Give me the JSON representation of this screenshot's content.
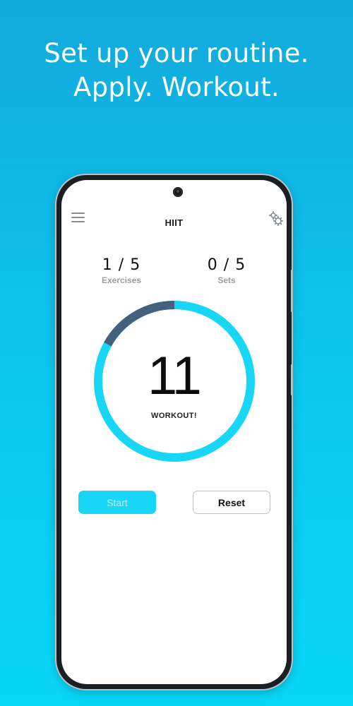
{
  "headline": {
    "line1": "Set up your routine.",
    "line2": "Apply. Workout."
  },
  "app": {
    "title": "HIIT",
    "menu_icon": "hamburger-menu-icon",
    "settings_icon": "gears-icon"
  },
  "stats": {
    "exercises": {
      "value": "1 / 5",
      "label": "Exercises"
    },
    "sets": {
      "value": "0 / 5",
      "label": "Sets"
    }
  },
  "timer": {
    "value": "11",
    "label": "WORKOUT!",
    "elapsed_fraction": 0.17,
    "colors": {
      "remaining": "#18d6f5",
      "elapsed": "#44607e"
    }
  },
  "controls": {
    "start_label": "Start",
    "reset_label": "Reset"
  },
  "colors": {
    "background_top": "#12a9dc",
    "background_bottom": "#08d6f6",
    "accent": "#18d6f5"
  }
}
